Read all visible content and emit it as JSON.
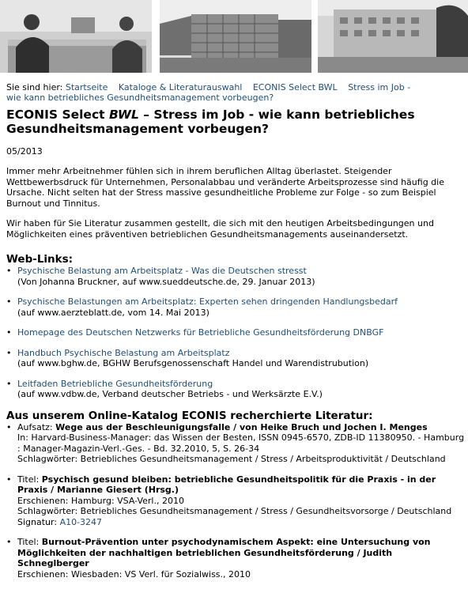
{
  "breadcrumb": {
    "prefix": "Sie sind hier:",
    "items": [
      "Startseite",
      "Kataloge & Literaturauswahl",
      "ECONIS Select BWL",
      "Stress im Job -",
      "wie kann betriebliches Gesundheitsmanagement vorbeugen?"
    ]
  },
  "page": {
    "title_a": "ECONIS Select ",
    "title_b": "BWL",
    "title_c": " – Stress im Job - wie kann betriebliches Gesundheitsmanagement vorbeugen?",
    "date": "05/2013",
    "intro1": "Immer mehr Arbeitnehmer fühlen sich in ihrem beruflichen Alltag überlastet. Steigender Wettbewerbsdruck für Unternehmen, Personalabbau und veränderte Arbeitsprozesse sind häufig die Ursache. Nicht selten hat der Stress massive gesundheitliche Probleme zur Folge - so zum Beispiel Burnout und Tinnitus.",
    "intro2": "Wir haben für Sie Literatur zusammen gestellt, die sich mit den heutigen Arbeitsbedingungen und Möglichkeiten eines präventiven betrieblichen Gesundheitsmanagements auseinandersetzt."
  },
  "weblinks": {
    "heading": "Web-Links:",
    "items": [
      {
        "link": "Psychische Belastung am Arbeitsplatz - Was die Deutschen stresst",
        "note": "(Von Johanna Bruckner, auf www.sueddeutsche.de, 29. Januar 2013)"
      },
      {
        "link": "Psychische Belastungen am Arbeitsplatz: Experten sehen dringenden Handlungsbedarf",
        "note": "(auf www.aerzteblatt.de, vom 14. Mai 2013)"
      },
      {
        "link": "Homepage des Deutschen Netzwerks für Betriebliche Gesundheitsförderung DNBGF",
        "note": ""
      },
      {
        "link": "Handbuch Psychische Belastung am Arbeitsplatz",
        "note": "(auf www.bghw.de, BGHW Berufsgenossenschaft Handel und Warendistrubution)"
      },
      {
        "link": "Leitfaden Betriebliche Gesundheitsförderung",
        "note": "(auf www.vdbw.de, Verband deutscher Betriebs - und Werksärzte E.V.)"
      }
    ]
  },
  "literature": {
    "heading": "Aus unserem Online-Katalog ECONIS recherchierte Literatur:",
    "items": [
      {
        "label": "Aufsatz: ",
        "title": "Wege aus der Beschleunigungsfalle / von Heike Bruch und Jochen I. Menges",
        "line1": "In: Harvard-Business-Manager: das Wissen der Besten, ISSN 0945-6570, ZDB-ID 11380950. - Hamburg : Manager-Magazin-Verl.-Ges. - Bd. 32.2010, 5, S. 26-34",
        "line2": "Schlagwörter: Betriebliches Gesundheitsmanagement / Stress / Arbeitsproduktivität / Deutschland",
        "sig_label": "",
        "sig": ""
      },
      {
        "label": "Titel: ",
        "title": "Psychisch gesund bleiben: betriebliche Gesundheitspolitik für die Praxis - in der Praxis / Marianne Giesert (Hrsg.)",
        "line1": "Erschienen: Hamburg: VSA-Verl., 2010",
        "line2": "Schlagwörter: Betriebliches Gesundheitsmanagement / Stress / Gesundheitsvorsorge / Deutschland",
        "sig_label": "Signatur: ",
        "sig": "A10-3247"
      },
      {
        "label": "Titel: ",
        "title": "Burnout-Prävention unter psychodynamischem Aspekt: eine Untersuchung von Möglichkeiten der nachhaltigen betrieblichen Gesundheitsförderung / Judith Schneglberger",
        "line1": "Erschienen: Wiesbaden: VS Verl. für Sozialwiss., 2010",
        "line2": "",
        "sig_label": "",
        "sig": ""
      }
    ]
  }
}
